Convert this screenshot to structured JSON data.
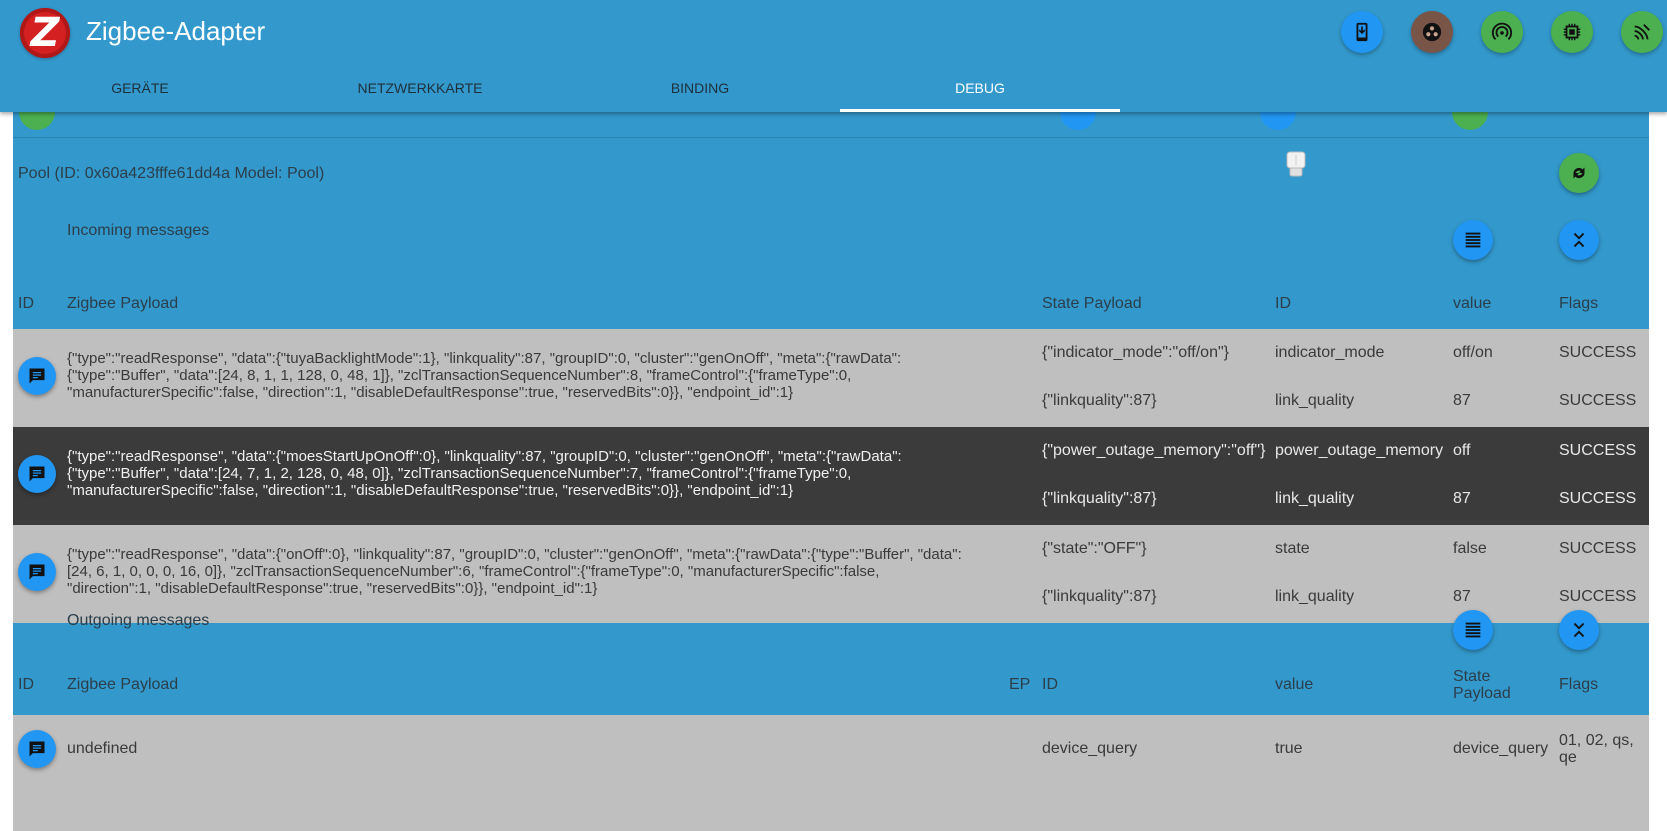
{
  "app": {
    "logo_letter": "Z",
    "title": "Zigbee-Adapter",
    "header_buttons": [
      {
        "icon": "phone-download-icon",
        "color": "#2196f3"
      },
      {
        "icon": "dots-circle-icon",
        "color": "#795548"
      },
      {
        "icon": "wifi-tethering-icon",
        "color": "#4caf50"
      },
      {
        "icon": "chip-icon",
        "color": "#4caf50"
      },
      {
        "icon": "signal-waves-icon",
        "color": "#4caf50"
      }
    ]
  },
  "tabs": [
    {
      "label": "GERÄTE",
      "active": false
    },
    {
      "label": "NETZWERKKARTE",
      "active": false
    },
    {
      "label": "BINDING",
      "active": false
    },
    {
      "label": "DEBUG",
      "active": true
    }
  ],
  "device": {
    "label": "Pool (ID: 0x60a423fffe61dd4a Model: Pool)",
    "refresh_icon": "refresh-icon"
  },
  "incoming": {
    "title": "Incoming messages",
    "columns": {
      "id": "ID",
      "zigbee_payload": "Zigbee Payload",
      "state_payload": "State Payload",
      "state_id": "ID",
      "value": "value",
      "flags": "Flags"
    },
    "rows": [
      {
        "payload": "{\"type\":\"readResponse\", \"data\":{\"tuyaBacklightMode\":1}, \"linkquality\":87, \"groupID\":0, \"cluster\":\"genOnOff\", \"meta\":{\"rawData\":{\"type\":\"Buffer\", \"data\":[24, 8, 1, 1, 128, 0, 48, 1]}, \"zclTransactionSequenceNumber\":8, \"frameControl\":{\"frameType\":0, \"manufacturerSpecific\":false, \"direction\":1, \"disableDefaultResponse\":true, \"reservedBits\":0}}, \"endpoint_id\":1}",
        "states": [
          {
            "state_payload": "{\"indicator_mode\":\"off/on\"}",
            "id": "indicator_mode",
            "value": "off/on",
            "flag": "SUCCESS"
          },
          {
            "state_payload": "{\"linkquality\":87}",
            "id": "link_quality",
            "value": "87",
            "flag": "SUCCESS"
          }
        ]
      },
      {
        "payload": "{\"type\":\"readResponse\", \"data\":{\"moesStartUpOnOff\":0}, \"linkquality\":87, \"groupID\":0, \"cluster\":\"genOnOff\", \"meta\":{\"rawData\":{\"type\":\"Buffer\", \"data\":[24, 7, 1, 2, 128, 0, 48, 0]}, \"zclTransactionSequenceNumber\":7, \"frameControl\":{\"frameType\":0, \"manufacturerSpecific\":false, \"direction\":1, \"disableDefaultResponse\":true, \"reservedBits\":0}}, \"endpoint_id\":1}",
        "states": [
          {
            "state_payload": "{\"power_outage_memory\":\"off\"}",
            "id": "power_outage_memory",
            "value": "off",
            "flag": "SUCCESS"
          },
          {
            "state_payload": "{\"linkquality\":87}",
            "id": "link_quality",
            "value": "87",
            "flag": "SUCCESS"
          }
        ]
      },
      {
        "payload": "{\"type\":\"readResponse\", \"data\":{\"onOff\":0}, \"linkquality\":87, \"groupID\":0, \"cluster\":\"genOnOff\", \"meta\":{\"rawData\":{\"type\":\"Buffer\", \"data\":[24, 6, 1, 0, 0, 0, 16, 0]}, \"zclTransactionSequenceNumber\":6, \"frameControl\":{\"frameType\":0, \"manufacturerSpecific\":false, \"direction\":1, \"disableDefaultResponse\":true, \"reservedBits\":0}}, \"endpoint_id\":1}",
        "states": [
          {
            "state_payload": "{\"state\":\"OFF\"}",
            "id": "state",
            "value": "false",
            "flag": "SUCCESS"
          },
          {
            "state_payload": "{\"linkquality\":87}",
            "id": "link_quality",
            "value": "87",
            "flag": "SUCCESS"
          }
        ]
      }
    ]
  },
  "outgoing": {
    "title": "Outgoing messages",
    "columns": {
      "id": "ID",
      "zigbee_payload": "Zigbee Payload",
      "ep": "EP",
      "state_id": "ID",
      "value": "value",
      "state_payload_line1": "State",
      "state_payload_line2": "Payload",
      "flags": "Flags"
    },
    "rows": [
      {
        "payload": "undefined",
        "id": "device_query",
        "value": "true",
        "state_payload": "device_query",
        "flags_line1": "01, 02, qs,",
        "flags_line2": "qe"
      }
    ]
  }
}
